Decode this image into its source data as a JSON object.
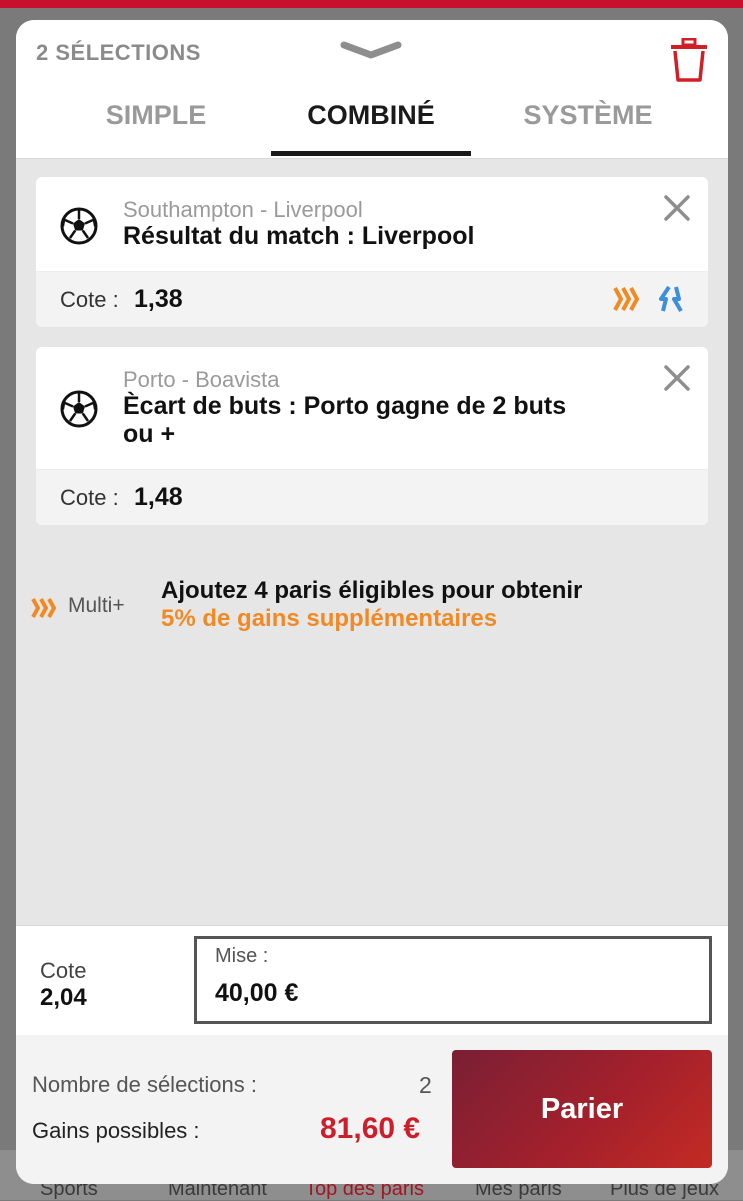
{
  "header": {
    "selection_count": "2 SÉLECTIONS"
  },
  "tabs": [
    {
      "label": "SIMPLE",
      "active": false
    },
    {
      "label": "COMBINÉ",
      "active": true
    },
    {
      "label": "SYSTÈME",
      "active": false
    }
  ],
  "bets": [
    {
      "match": "Southampton - Liverpool",
      "market": "Résultat du match : Liverpool",
      "odds_label": "Cote :",
      "odds": "1,38",
      "icons": [
        "multi-plus-icon",
        "boost-arrows-icon"
      ]
    },
    {
      "match": "Porto - Boavista",
      "market": "Ècart de buts : Porto gagne de 2 buts ou +",
      "odds_label": "Cote :",
      "odds": "1,48"
    }
  ],
  "promo": {
    "label": "Multi+",
    "line1": "Ajoutez 4 paris éligibles pour obtenir",
    "line2": "5% de gains supplémentaires"
  },
  "stake": {
    "total_odds_label": "Cote",
    "total_odds": "2,04",
    "stake_label": "Mise :",
    "stake_value": "40,00 €"
  },
  "summary": {
    "selections_label": "Nombre de sélections :",
    "selections_value": "2",
    "gains_label": "Gains possibles :",
    "gains_value": "81,60 €",
    "submit_label": "Parier"
  },
  "bottom_nav": {
    "items": [
      "Sports",
      "Maintenant",
      "Top des paris",
      "Mes paris",
      "Plus de jeux"
    ]
  },
  "colors": {
    "brand_red": "#c8102e",
    "promo_orange": "#f08a24",
    "gain_red": "#cc1f2b",
    "boost_blue": "#3d8fdc"
  }
}
